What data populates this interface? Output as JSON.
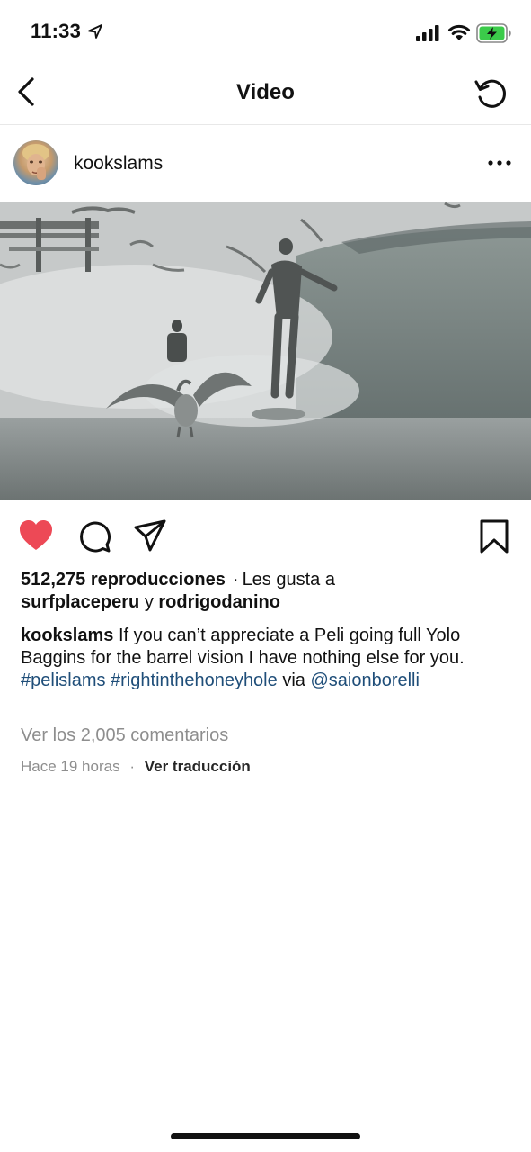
{
  "status_bar": {
    "time": "11:33"
  },
  "header": {
    "title": "Video"
  },
  "post": {
    "author": "kookslams",
    "views_count": "512,275 reproducciones",
    "separator": "·",
    "likes_prefix": "Les gusta a",
    "liker_1": "surfplaceperu",
    "likes_conjunction": "y",
    "liker_2": "rodrigodanino",
    "caption_author": "kookslams",
    "caption_text": "If you can’t appreciate a Peli going full Yolo Baggins for the barrel vision I have nothing else for you.",
    "hashtag_1": "#pelislams",
    "hashtag_2": "#rightinthehoneyhole",
    "via_text": "via",
    "mention": "@saionborelli",
    "comments_link": "Ver los 2,005 comentarios",
    "timestamp": "Hace 19 horas",
    "meta_separator": "·",
    "translate_label": "Ver traducción",
    "liked": true
  },
  "icons": {
    "status": [
      "location-arrow-icon",
      "signal-bars-icon",
      "wifi-icon",
      "battery-charging-icon"
    ],
    "header": [
      "chevron-left-icon",
      "refresh-icon"
    ],
    "post": [
      "more-horizontal-icon",
      "heart-icon",
      "comment-icon",
      "send-icon",
      "bookmark-icon"
    ]
  },
  "colors": {
    "like_red": "#ED4956",
    "link_blue": "#1F4E79",
    "muted_gray": "#8E8E8E",
    "battery_green": "#3BCB4A"
  }
}
